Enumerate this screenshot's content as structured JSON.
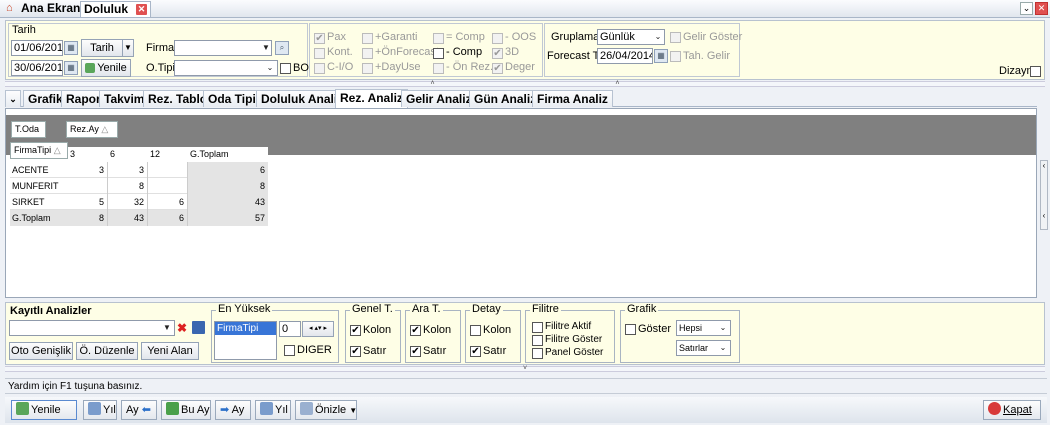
{
  "tabs": {
    "home": "Ana Ekran",
    "doluluk": "Doluluk"
  },
  "filter": {
    "tarih_label": "Tarih",
    "start_date": "01/06/2010",
    "end_date": "30/06/2011",
    "tarih_btn": "Tarih",
    "yenile_btn": "Yenile",
    "firma_label": "Firma",
    "otipi_label": "O.Tipi",
    "bo_label": "BO",
    "c_pax": "Pax",
    "c_kont": "Kont.",
    "c_cio": "C-I/O",
    "c_garanti": "+Garanti",
    "c_onforecast": "+ÖnForecast",
    "c_dayuse": "+DayUse",
    "c_eqcomp": "= Comp",
    "c_comp": "- Comp",
    "c_onrez": "- Ön Rez.",
    "c_oos": "- OOS",
    "c_3d": "3D",
    "c_deger": "Deger",
    "gruplama_label": "Gruplama",
    "gruplama_value": "Günlük",
    "forecast_label": "Forecast T.",
    "forecast_date": "26/04/2014",
    "gelir_goster": "Gelir Göster",
    "tah_gelir": "Tah. Gelir",
    "dizayn": "Dizayn"
  },
  "analysis_tabs": [
    "Grafik",
    "Rapor",
    "Takvim",
    "Rez. Tablo",
    "Oda Tipi",
    "Doluluk Analiz",
    "Rez. Analiz",
    "Gelir Analiz",
    "Gün Analiz",
    "Firma Analiz"
  ],
  "pivot": {
    "row_field": "T.Oda",
    "col_field": "Rez.Ay",
    "row_field2": "FirmaTipi",
    "sort_glyph": "△",
    "columns": [
      "3",
      "6",
      "12",
      "G.Toplam"
    ],
    "rows": [
      {
        "label": "ACENTE",
        "values": [
          "3",
          "3",
          "",
          "6"
        ]
      },
      {
        "label": "MUNFERIT",
        "values": [
          "",
          "8",
          "",
          "8"
        ]
      },
      {
        "label": "SIRKET",
        "values": [
          "5",
          "32",
          "6",
          "43"
        ]
      },
      {
        "label": "G.Toplam",
        "values": [
          "8",
          "43",
          "6",
          "57"
        ]
      }
    ]
  },
  "bottom": {
    "kayitli": "Kayıtlı Analizler",
    "oto": "Oto Genişlik",
    "duzenle": "Ö. Düzenle",
    "yeni": "Yeni Alan",
    "en_yuksek": "En Yüksek",
    "list_item": "FirmaTipi",
    "spin_value": "0",
    "diger": "DIGER",
    "genel": "Genel T.",
    "ara": "Ara T.",
    "detay": "Detay",
    "kolon": "Kolon",
    "satir": "Satır",
    "filitre": "Filitre",
    "filitre_aktif": "Filitre Aktif",
    "filitre_goster": "Filitre Göster",
    "panel_goster": "Panel Göster",
    "grafik": "Grafik",
    "goster": "Göster",
    "hepsi": "Hepsi",
    "satirlar": "Satırlar"
  },
  "status": "Yardım için F1 tuşuna basınız.",
  "toolbar": {
    "yenile": "Yenile",
    "yil_back": "Yıl",
    "ay_back": "Ay",
    "bu_ay": "Bu Ay",
    "ay_fwd": "Ay",
    "yil_fwd": "Yıl",
    "onizle": "Önizle",
    "kapat": "Kapat"
  }
}
